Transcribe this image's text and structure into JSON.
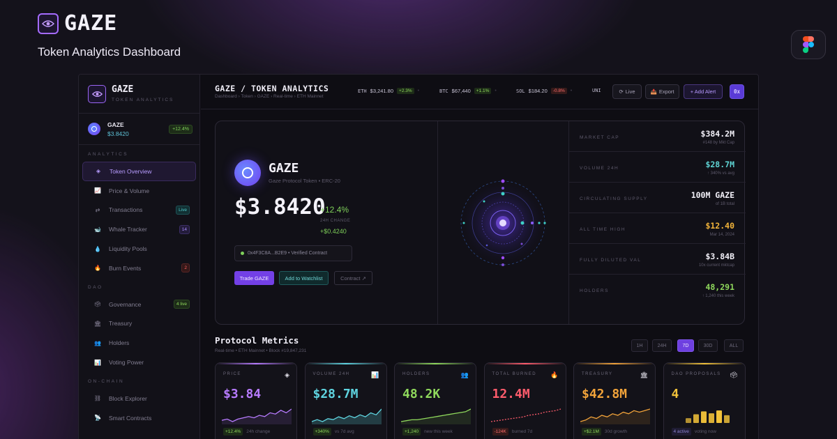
{
  "brand": {
    "name": "GAZE",
    "subtitle": "Token Analytics Dashboard"
  },
  "icons": {
    "brand_logo": "eye-icon",
    "figma": "figma-icon"
  },
  "sidebar": {
    "title": "GAZE",
    "tagline": "TOKEN ANALYTICS",
    "token": {
      "name": "GAZE",
      "price": "$3.8420",
      "change": "+12.4%"
    },
    "sections": {
      "analytics": "ANALYTICS",
      "dao": "DAO",
      "onchain": "ON-CHAIN"
    },
    "items": [
      {
        "label": "Token Overview",
        "icon": "diamond-icon",
        "badge": ""
      },
      {
        "label": "Price & Volume",
        "icon": "chart-icon",
        "badge": ""
      },
      {
        "label": "Transactions",
        "icon": "exchange-icon",
        "badge": "Live"
      },
      {
        "label": "Whale Tracker",
        "icon": "whale-icon",
        "badge": "14"
      },
      {
        "label": "Liquidity Pools",
        "icon": "droplet-icon",
        "badge": ""
      },
      {
        "label": "Burn Events",
        "icon": "flame-icon",
        "badge": "2"
      },
      {
        "label": "Governance",
        "icon": "ballot-icon",
        "badge": "4 live"
      },
      {
        "label": "Treasury",
        "icon": "bank-icon",
        "badge": ""
      },
      {
        "label": "Holders",
        "icon": "users-icon",
        "badge": ""
      },
      {
        "label": "Voting Power",
        "icon": "bar-chart-icon",
        "badge": ""
      },
      {
        "label": "Block Explorer",
        "icon": "link-icon",
        "badge": ""
      },
      {
        "label": "Smart Contracts",
        "icon": "satellite-icon",
        "badge": ""
      }
    ]
  },
  "topbar": {
    "title": "GAZE / TOKEN ANALYTICS",
    "breadcrumb": "Dashboard › Token › GAZE › Real-time › ETH Mainnet",
    "tickers": [
      {
        "sym": "ETH",
        "val": "$3,241.80",
        "chg": "+2.3%",
        "dir": "up"
      },
      {
        "sym": "BTC",
        "val": "$67,440",
        "chg": "+1.1%",
        "dir": "up"
      },
      {
        "sym": "SOL",
        "val": "$184.20",
        "chg": "-0.8%",
        "dir": "down"
      },
      {
        "sym": "UNI",
        "val": "",
        "chg": "",
        "dir": ""
      }
    ],
    "buttons": {
      "live": "Live",
      "export": "Export",
      "alert": "+ Add Alert",
      "wallet": "0x"
    }
  },
  "hero": {
    "name": "GAZE",
    "subtitle": "Gaze Protocol Token • ERC-20",
    "price": "$3.8420",
    "change": "+12.4%",
    "change_label": "24H CHANGE",
    "change_abs": "+$0.4240",
    "contract": "0x4F3C8A...B2E9 • Verified Contract",
    "btn_trade": "Trade GAZE",
    "btn_watch": "Add to Watchlist",
    "btn_contract": "Contract ↗"
  },
  "stats": [
    {
      "label": "MARKET CAP",
      "value": "$384.2M",
      "sub": "#148 by Mkt Cap",
      "color": "#f2f0f8"
    },
    {
      "label": "VOLUME 24H",
      "value": "$28.7M",
      "sub": "↑ 340% vs avg",
      "color": "#5fd4d4"
    },
    {
      "label": "CIRCULATING SUPPLY",
      "value": "100M GAZE",
      "sub": "of 1B total",
      "color": "#f2f0f8"
    },
    {
      "label": "ALL TIME HIGH",
      "value": "$12.40",
      "sub": "Mar 14, 2024",
      "color": "#f2b43a"
    },
    {
      "label": "FULLY DILUTED VAL",
      "value": "$3.84B",
      "sub": "10x current mktcap",
      "color": "#f2f0f8"
    },
    {
      "label": "HOLDERS",
      "value": "48,291",
      "sub": "↑ 1,240 this week",
      "color": "#8fd85c"
    }
  ],
  "metrics": {
    "title": "Protocol Metrics",
    "subtitle": "Real-time • ETH Mainnet • Block #19,847,231",
    "timeframes": [
      "1H",
      "24H",
      "7D",
      "30D",
      "ALL"
    ],
    "active_timeframe": "7D",
    "cards": [
      {
        "label": "PRICE",
        "icon": "diamond-icon",
        "value": "$3.84",
        "chip": "+12.4%",
        "note": "24h change",
        "color": "#b77bff",
        "chip_color": "#8fd85c",
        "chip_bg": "#1d2c18",
        "spark": [
          14,
          13,
          15,
          13,
          12,
          11,
          12,
          10,
          11,
          8,
          9,
          6,
          8,
          5
        ],
        "spark_style": "line"
      },
      {
        "label": "VOLUME 24H",
        "icon": "chart-icon",
        "value": "$28.7M",
        "chip": "+340%",
        "note": "vs 7d avg",
        "color": "#5fd4e0",
        "chip_color": "#8fd85c",
        "chip_bg": "#1d2c18",
        "spark": [
          18,
          16,
          18,
          15,
          16,
          13,
          15,
          12,
          14,
          11,
          13,
          9,
          11,
          5
        ],
        "spark_style": "area"
      },
      {
        "label": "HOLDERS",
        "icon": "users-icon",
        "value": "48.2K",
        "chip": "+1,240",
        "note": "new this week",
        "color": "#8fd85c",
        "chip_color": "#8fd85c",
        "chip_bg": "#1d2c18",
        "spark": [
          20,
          19,
          18,
          18,
          17,
          16,
          15,
          14,
          13,
          12,
          11,
          10,
          9,
          6
        ],
        "spark_style": "line"
      },
      {
        "label": "TOTAL BURNED",
        "icon": "flame-icon",
        "value": "12.4M",
        "chip": "-124K",
        "note": "burned 7d",
        "color": "#ff5c6c",
        "chip_color": "#ff6b6b",
        "chip_bg": "#351a1a",
        "spark": [
          22,
          21,
          20,
          19,
          18,
          17,
          16,
          14,
          13,
          12,
          10,
          9,
          8,
          6
        ],
        "spark_style": "dashed"
      },
      {
        "label": "TREASURY",
        "icon": "bank-icon",
        "value": "$42.8M",
        "chip": "+$2.1M",
        "note": "30d growth",
        "color": "#f2a33a",
        "chip_color": "#8fd85c",
        "chip_bg": "#1d2c18",
        "spark": [
          16,
          15,
          13,
          14,
          12,
          13,
          11,
          12,
          10,
          11,
          9,
          10,
          9,
          8
        ],
        "spark_style": "line"
      },
      {
        "label": "DAO PROPOSALS",
        "icon": "ballot-icon",
        "value": "4",
        "chip": "4 active",
        "note": "voting now",
        "color": "#f2c23a",
        "chip_color": "#8b82d0",
        "chip_bg": "#1f1c33",
        "spark": [
          5,
          9,
          12,
          10,
          13,
          8
        ],
        "spark_style": "bars"
      }
    ]
  }
}
